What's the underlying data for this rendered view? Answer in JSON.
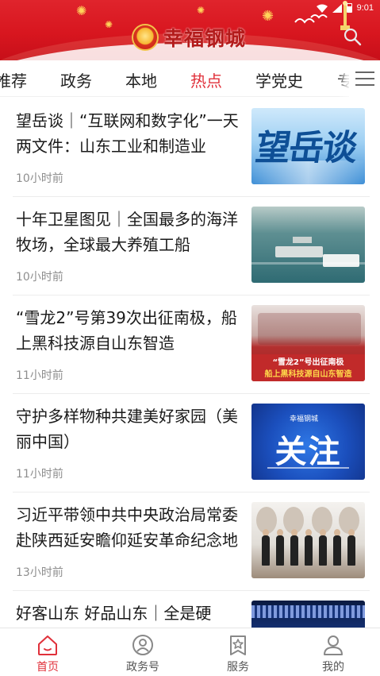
{
  "status_bar": {
    "time": "9:01"
  },
  "header": {
    "app_title": "幸福钢城"
  },
  "tabs": [
    {
      "label": "推荐"
    },
    {
      "label": "政务"
    },
    {
      "label": "本地"
    },
    {
      "label": "热点",
      "active": true
    },
    {
      "label": "学党史"
    },
    {
      "label": "专"
    }
  ],
  "feed": [
    {
      "title": "望岳谈｜“互联网和数字化”一天两文件：山东工业和制造业",
      "time": "10小时前",
      "thumb_text": "望岳谈"
    },
    {
      "title": "十年卫星图见｜全国最多的海洋牧场，全球最大养殖工船",
      "time": "10小时前"
    },
    {
      "title": "“雪龙2”号第39次出征南极，船上黑科技源自山东智造",
      "time": "11小时前",
      "thumb_caption_1": "“雪龙2”号出征南极",
      "thumb_caption_2": "船上黑科技源自山东智造"
    },
    {
      "title": "守护多样物种共建美好家园（美丽中国）",
      "time": "11小时前",
      "thumb_logo": "幸福钢城",
      "thumb_text": "关注"
    },
    {
      "title": "习近平带领中共中央政治局常委赴陕西延安瞻仰延安革命纪念地",
      "time": "13小时前"
    },
    {
      "title": "好客山东 好品山东｜全是硬",
      "time": ""
    }
  ],
  "bottom_nav": [
    {
      "label": "首页",
      "icon": "home-icon",
      "active": true
    },
    {
      "label": "政务号",
      "icon": "gov-account-icon"
    },
    {
      "label": "服务",
      "icon": "service-star-icon"
    },
    {
      "label": "我的",
      "icon": "profile-icon"
    }
  ],
  "colors": {
    "brand_red": "#e0242c",
    "active_text": "#e0303a"
  }
}
